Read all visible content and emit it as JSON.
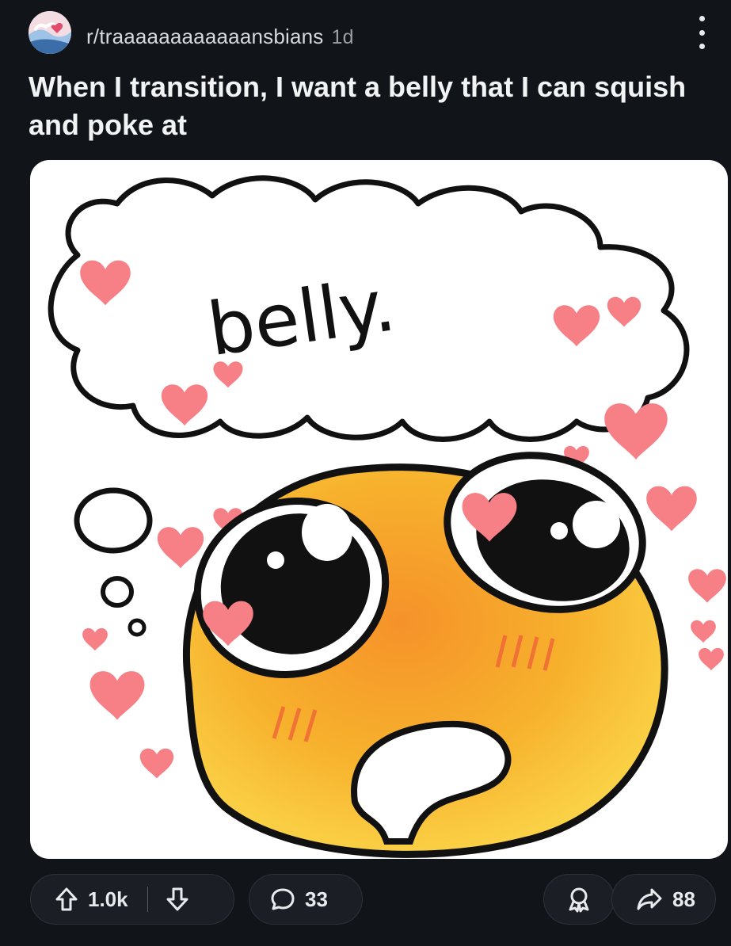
{
  "post": {
    "subreddit": "r/traaaaaaaaaaaansbians",
    "age": "1d",
    "title": "When I transition, I want a belly that I can squish and poke at",
    "image_text": "belly."
  },
  "actions": {
    "upvotes": "1.0k",
    "comments": "33",
    "shares": "88"
  },
  "icons": {
    "upvote": "arrow-up-icon",
    "downvote": "arrow-down-icon",
    "comment": "speech-bubble-icon",
    "award": "award-icon",
    "share": "share-arrow-icon",
    "menu": "kebab-menu-icon"
  },
  "colors": {
    "background": "#111419",
    "heart": "#f77f86",
    "face": "#f6a623"
  }
}
